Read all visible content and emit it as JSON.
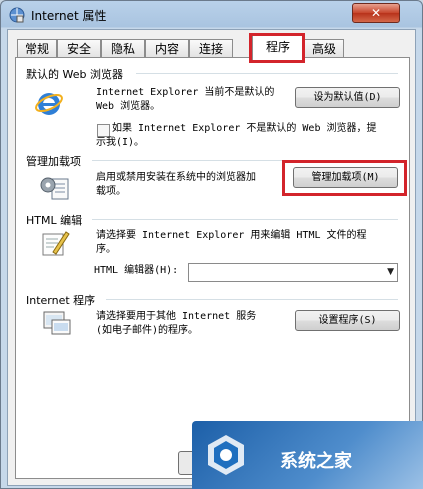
{
  "window": {
    "title": "Internet 属性",
    "close_label": "✕"
  },
  "tabs": [
    {
      "label": "常规"
    },
    {
      "label": "安全"
    },
    {
      "label": "隐私"
    },
    {
      "label": "内容"
    },
    {
      "label": "连接"
    },
    {
      "label": "程序",
      "active": true
    },
    {
      "label": "高级"
    }
  ],
  "default_browser": {
    "group_title": "默认的 Web 浏览器",
    "description_line1": "Internet Explorer 当前不是默认的",
    "description_line2": "Web 浏览器。",
    "set_default_button": "设为默认值(D)",
    "checkbox_line1": "如果 Internet Explorer 不是默认的 Web 浏览器，提",
    "checkbox_line2": "示我(I)。",
    "checkbox_checked": false
  },
  "addons": {
    "group_title": "管理加载项",
    "description_line1": "启用或禁用安装在系统中的浏览器加",
    "description_line2": "载项。",
    "manage_button": "管理加载项(M)"
  },
  "html_editing": {
    "group_title": "HTML 编辑",
    "description_line1": "请选择要 Internet Explorer 用来编辑 HTML 文件的程",
    "description_line2": "序。",
    "editor_label": "HTML 编辑器(H):",
    "editor_value": ""
  },
  "internet_programs": {
    "group_title": "Internet 程序",
    "description_line1": "请选择要用于其他 Internet 服务",
    "description_line2": "(如电子邮件)的程序。",
    "set_programs_button": "设置程序(S)"
  },
  "watermark": {
    "text": "系统之家"
  },
  "colors": {
    "highlight": "#d3242b",
    "titlebar": "#b9d1ea",
    "close": "#c7452b"
  }
}
